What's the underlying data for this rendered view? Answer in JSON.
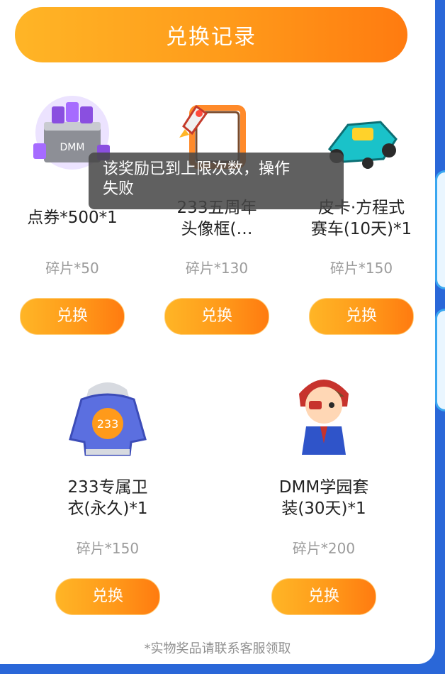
{
  "header": {
    "title": "兑换记录"
  },
  "items": [
    {
      "name_line1": "点券*500*1",
      "name_line2": "",
      "cost": "碎片*50",
      "button": "兑换",
      "icon": "coupon-box-icon"
    },
    {
      "name_line1": "233五周年",
      "name_line2": "头像框(…",
      "cost": "碎片*130",
      "button": "兑换",
      "icon": "avatar-frame-icon"
    },
    {
      "name_line1": "皮卡·方程式",
      "name_line2": "赛车(10天)*1",
      "cost": "碎片*150",
      "button": "兑换",
      "icon": "race-car-icon"
    },
    {
      "name_line1": "233专属卫",
      "name_line2": "衣(永久)*1",
      "cost": "碎片*150",
      "button": "兑换",
      "icon": "hoodie-icon"
    },
    {
      "name_line1": "DMM学园套",
      "name_line2": "装(30天)*1",
      "cost": "碎片*200",
      "button": "兑换",
      "icon": "character-outfit-icon"
    }
  ],
  "toast": {
    "line1": "该奖励已到上限次数，操作",
    "line2": "失败"
  },
  "footnote": "*实物奖品请联系客服领取"
}
